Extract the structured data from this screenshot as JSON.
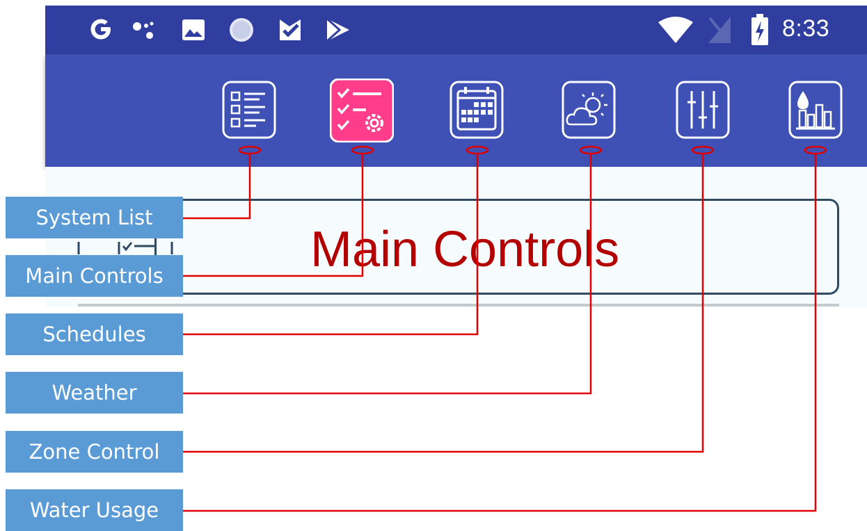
{
  "status_bar": {
    "time": "8:33",
    "left_icons": [
      "google-icon",
      "assistant-dots-icon",
      "gallery-icon",
      "spinner-icon",
      "task-check-icon",
      "play-store-icon"
    ],
    "right_icons": [
      "wifi-icon",
      "no-sim-icon",
      "battery-charging-icon"
    ]
  },
  "tabs": [
    {
      "name": "system-list",
      "icon": "list-icon",
      "active": false
    },
    {
      "name": "main-controls",
      "icon": "checklist-gear-icon",
      "active": true
    },
    {
      "name": "schedules",
      "icon": "calendar-icon",
      "active": false
    },
    {
      "name": "weather",
      "icon": "sun-cloud-icon",
      "active": false
    },
    {
      "name": "zone-control",
      "icon": "sliders-icon",
      "active": false
    },
    {
      "name": "water-usage",
      "icon": "water-bars-icon",
      "active": false
    }
  ],
  "page": {
    "title": "Main Controls"
  },
  "callouts": [
    {
      "label": "System List"
    },
    {
      "label": "Main Controls"
    },
    {
      "label": "Schedules"
    },
    {
      "label": "Weather"
    },
    {
      "label": "Zone Control"
    },
    {
      "label": "Water Usage"
    }
  ],
  "colors": {
    "status_bar": "#303f9f",
    "toolbar": "#3f51b5",
    "active_tab": "#ff3d8b",
    "title_text": "#b30000",
    "callout_box": "#5b9bd5",
    "callout_line": "#e00000"
  }
}
